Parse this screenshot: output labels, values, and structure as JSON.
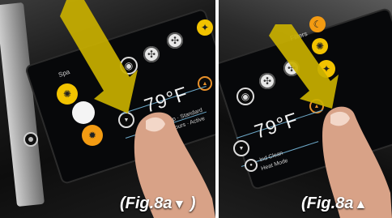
{
  "left_panel": {
    "caption_prefix": "(Fig.8a",
    "caption_symbol": "▼",
    "caption_suffix": " )",
    "screen_label": "Spa",
    "temperature": "79°F",
    "status_line1": "Lo Temp · Standard",
    "status_line2": "Heat Hours · Active",
    "arrow_color": "#c9b000"
  },
  "right_panel": {
    "caption_prefix": "(Fig.8a",
    "caption_symbol": "▲",
    "caption_suffix": "",
    "screen_label": "Filters",
    "temperature": "79°F",
    "status_line1": "Ind Clean",
    "status_line2": "Heat Mode",
    "arrow_color": "#c9b000"
  }
}
